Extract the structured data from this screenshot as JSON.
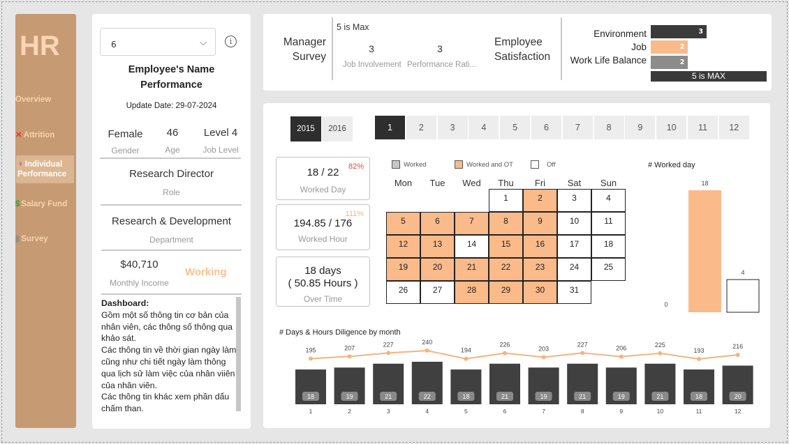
{
  "sidebar": {
    "logo": "HR",
    "items": [
      {
        "label": "Overview",
        "icon": ""
      },
      {
        "label": "Attrition",
        "icon": "✕"
      },
      {
        "label": "Individual Performance",
        "icon": "♀"
      },
      {
        "label": "Salary Fund",
        "icon": "$"
      },
      {
        "label": "Survey",
        "icon": "▮"
      }
    ],
    "active_index": 2
  },
  "profile": {
    "employee_select": "6",
    "title_line1": "Employee's Name",
    "title_line2": "Performance",
    "update_date": "Update Date: 29-07-2024",
    "gender": "Female",
    "gender_label": "Gender",
    "age": "46",
    "age_label": "Age",
    "job_level": "Level 4",
    "job_level_label": "Job Level",
    "role": "Research Director",
    "role_label": "Role",
    "department": "Research & Development",
    "department_label": "Department",
    "income": "$40,710",
    "income_label": "Monthly Income",
    "status": "Working",
    "desc_title": "Dashboard:",
    "desc_lines": [
      "Gồm một số thông tin cơ bản của",
      "nhân viên, các thông số thông qua",
      "khảo sát.",
      "Các thông tin về thời gian ngày làm",
      "cũng như chi tiết ngày làm thông",
      "qua lịch sử làm việc của nhân viiên",
      "của nhân viên.",
      "Các thông tin khác xem phần dấu",
      "chấm than."
    ]
  },
  "survey": {
    "manager_label1": "Manager",
    "manager_label2": "Survey",
    "scale_note": "5 is Max",
    "job_involvement": "3",
    "job_involvement_label": "Job Involvement",
    "performance": "3",
    "performance_label": "Performance Rati...",
    "satisfaction_label1": "Employee",
    "satisfaction_label2": "Satisfaction",
    "bars": [
      {
        "label": "Environment",
        "value": 3,
        "color": "#3a3a3a"
      },
      {
        "label": "Job",
        "value": 2,
        "color": "#fbba8a"
      },
      {
        "label": "Work Life Balance",
        "value": 2,
        "color": "#8c8c8c"
      }
    ],
    "max_label": "5 is MAX",
    "max_value": 5
  },
  "filters": {
    "years": [
      "2015",
      "2016"
    ],
    "selected_year": "2015",
    "months": [
      "1",
      "2",
      "3",
      "4",
      "5",
      "6",
      "7",
      "8",
      "9",
      "10",
      "11",
      "12"
    ],
    "selected_month": "1"
  },
  "kpis": {
    "worked_day": "18 / 22",
    "worked_day_pct": "82%",
    "worked_day_label": "Worked Day",
    "worked_hour": "194.85 / 176",
    "worked_hour_pct": "111%",
    "worked_hour_label": "Worked Hour",
    "overtime_days": "18 days",
    "overtime_hours": "( 50.85 Hours )",
    "overtime_label": "Over Time"
  },
  "calendar": {
    "legend": [
      "Worked",
      "Worked and OT",
      "Off"
    ],
    "legend_colors": [
      "#c8c8c8",
      "#fbba8a",
      "#ffffff"
    ],
    "weekdays": [
      "Mon",
      "Tue",
      "Wed",
      "Thu",
      "Fri",
      "Sat",
      "Sun"
    ],
    "days": [
      {
        "d": "1",
        "s": "off"
      },
      {
        "d": "2",
        "s": "ot"
      },
      {
        "d": "3",
        "s": "off"
      },
      {
        "d": "4",
        "s": "off"
      },
      {
        "d": "5",
        "s": "ot"
      },
      {
        "d": "6",
        "s": "ot"
      },
      {
        "d": "7",
        "s": "ot"
      },
      {
        "d": "8",
        "s": "ot"
      },
      {
        "d": "9",
        "s": "ot"
      },
      {
        "d": "10",
        "s": "off"
      },
      {
        "d": "11",
        "s": "off"
      },
      {
        "d": "12",
        "s": "ot"
      },
      {
        "d": "13",
        "s": "ot"
      },
      {
        "d": "14",
        "s": "off"
      },
      {
        "d": "15",
        "s": "ot"
      },
      {
        "d": "16",
        "s": "ot"
      },
      {
        "d": "17",
        "s": "off"
      },
      {
        "d": "18",
        "s": "off"
      },
      {
        "d": "19",
        "s": "ot"
      },
      {
        "d": "20",
        "s": "ot"
      },
      {
        "d": "21",
        "s": "ot"
      },
      {
        "d": "22",
        "s": "ot"
      },
      {
        "d": "23",
        "s": "ot"
      },
      {
        "d": "24",
        "s": "off"
      },
      {
        "d": "25",
        "s": "off"
      },
      {
        "d": "26",
        "s": "off"
      },
      {
        "d": "27",
        "s": "off"
      },
      {
        "d": "28",
        "s": "ot"
      },
      {
        "d": "29",
        "s": "ot"
      },
      {
        "d": "30",
        "s": "ot"
      },
      {
        "d": "31",
        "s": "off"
      }
    ],
    "first_weekday_index": 3
  },
  "chart_data": [
    {
      "type": "bar",
      "title": "# Worked day",
      "categories": [
        "Worked and OT",
        "Off"
      ],
      "values": [
        18,
        4
      ],
      "value_labels": [
        "18",
        "4"
      ],
      "baseline_label": "0",
      "colors": [
        "#fbba8a",
        "#ffffff"
      ]
    },
    {
      "type": "bar",
      "title": "# Days & Hours Diligence by month",
      "categories": [
        "1",
        "2",
        "3",
        "4",
        "5",
        "6",
        "7",
        "8",
        "9",
        "10",
        "11",
        "12"
      ],
      "series": [
        {
          "name": "Days",
          "values": [
            18,
            19,
            21,
            22,
            18,
            21,
            19,
            21,
            19,
            21,
            18,
            20
          ]
        },
        {
          "name": "Hours",
          "values": [
            195,
            207,
            227,
            240,
            194,
            226,
            203,
            227,
            206,
            225,
            193,
            216
          ]
        }
      ],
      "colors": {
        "bars": "#404040",
        "line": "#f5b37e"
      }
    }
  ]
}
